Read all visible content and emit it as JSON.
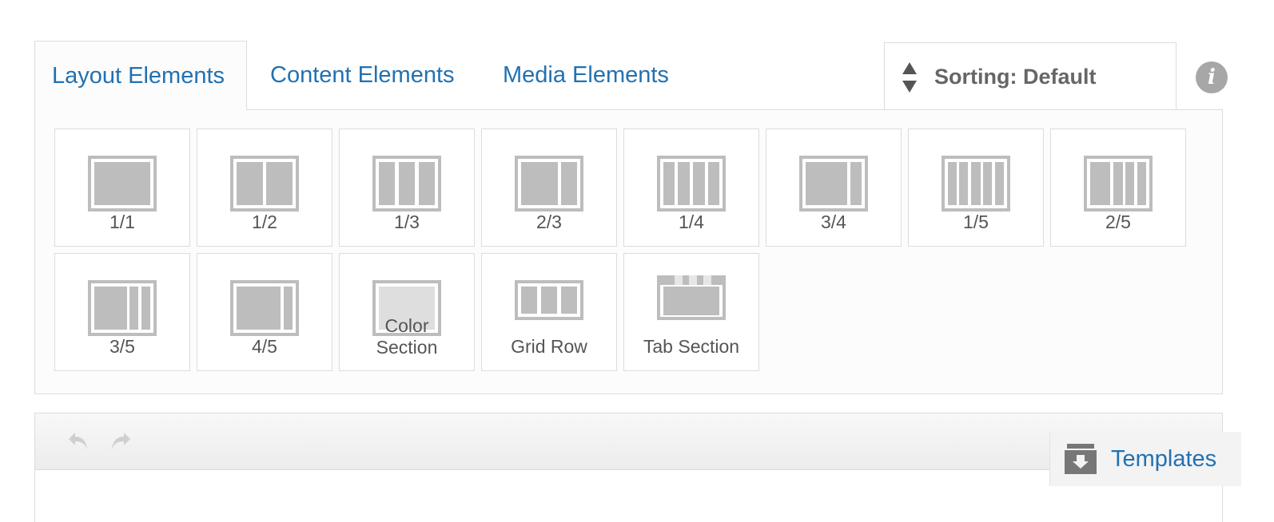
{
  "tabs": [
    {
      "label": "Layout Elements",
      "active": true
    },
    {
      "label": "Content Elements",
      "active": false
    },
    {
      "label": "Media Elements",
      "active": false
    }
  ],
  "sorting": {
    "label": "Sorting: Default",
    "icon": "sort-arrows-icon"
  },
  "info": {
    "icon": "info-icon",
    "glyph": "i"
  },
  "layout_elements": [
    {
      "label": "1/1",
      "icon": "column-1-1-icon"
    },
    {
      "label": "1/2",
      "icon": "column-1-2-icon"
    },
    {
      "label": "1/3",
      "icon": "column-1-3-icon"
    },
    {
      "label": "2/3",
      "icon": "column-2-3-icon"
    },
    {
      "label": "1/4",
      "icon": "column-1-4-icon"
    },
    {
      "label": "3/4",
      "icon": "column-3-4-icon"
    },
    {
      "label": "1/5",
      "icon": "column-1-5-icon"
    },
    {
      "label": "2/5",
      "icon": "column-2-5-icon"
    },
    {
      "label": "3/5",
      "icon": "column-3-5-icon"
    },
    {
      "label": "4/5",
      "icon": "column-4-5-icon"
    },
    {
      "label": "Color",
      "label_line2": "Section",
      "icon": "color-section-icon"
    },
    {
      "label": "Grid Row",
      "icon": "grid-row-icon"
    },
    {
      "label": "Tab Section",
      "icon": "tab-section-icon"
    }
  ],
  "toolbar": {
    "undo_icon": "undo-icon",
    "redo_icon": "redo-icon"
  },
  "templates": {
    "label": "Templates",
    "icon": "templates-box-icon"
  },
  "colors": {
    "link": "#2271b1",
    "icon_gray": "#bdbdbd",
    "border": "#dcdcdc"
  }
}
